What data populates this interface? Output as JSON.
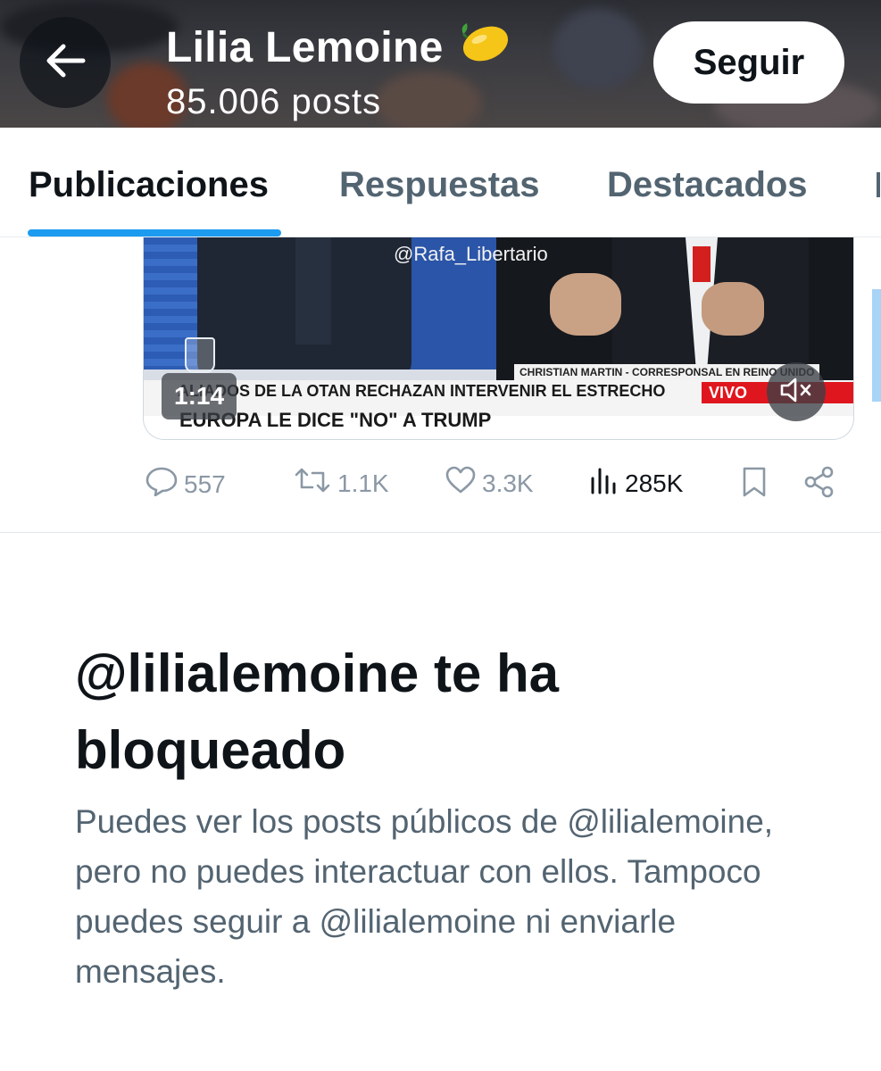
{
  "header": {
    "name": "Lilia Lemoine",
    "name_emoji": "lemon-icon",
    "post_count": "85.006 posts",
    "follow_label": "Seguir"
  },
  "tabs": [
    {
      "label": "Publicaciones",
      "active": true
    },
    {
      "label": "Respuestas",
      "active": false
    },
    {
      "label": "Destacados",
      "active": false
    }
  ],
  "video": {
    "watermark": "@Rafa_Libertario",
    "correspondent": "CHRISTIAN MARTIN - CORRESPONSAL EN REINO UNIDO",
    "headline_1": "ALIADOS DE LA OTAN RECHAZAN INTERVENIR EL ESTRECHO",
    "headline_2": "EUROPA LE DICE \"NO\" A TRUMP",
    "live_label": "VIVO",
    "duration": "1:14",
    "muted": true
  },
  "post_actions": {
    "replies": "557",
    "reposts": "1.1K",
    "likes": "3.3K",
    "views": "285K"
  },
  "blocked": {
    "title": "@lilialemoine te ha bloqueado",
    "message": "Puedes ver los posts públicos de @lilialemoine, pero no puedes interactuar con ellos. Tampoco puedes seguir a @lilialemoine ni enviarle mensajes."
  },
  "colors": {
    "accent": "#1d9bf0",
    "text_primary": "#0f1419",
    "text_secondary": "#536471",
    "action_muted": "#8b98a5",
    "live_red": "#e0161e"
  }
}
